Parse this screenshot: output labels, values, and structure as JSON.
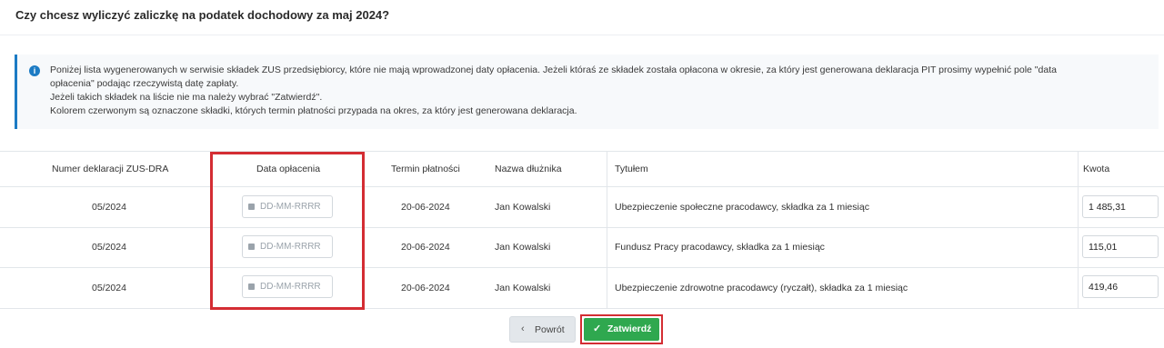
{
  "page": {
    "title": "Czy chcesz wyliczyć zaliczkę na podatek dochodowy za maj 2024?"
  },
  "info": {
    "icon": "info-circle-icon",
    "lines": [
      "Poniżej lista wygenerowanych w serwisie składek ZUS przedsiębiorcy, które nie mają wprowadzonej daty opłacenia. Jeżeli któraś ze składek została opłacona w okresie, za który jest generowana deklaracja PIT prosimy wypełnić pole \"data",
      "opłacenia\" podając rzeczywistą datę zapłaty.",
      "Jeżeli takich składek na liście nie ma należy wybrać \"Zatwierdź\".",
      "Kolorem czerwonym są oznaczone składki, których termin płatności przypada na okres, za który jest generowana deklaracja."
    ]
  },
  "table": {
    "headers": {
      "declaration": "Numer deklaracji ZUS-DRA",
      "payment_date": "Data opłacenia",
      "due_date": "Termin płatności",
      "debtor": "Nazwa dłużnika",
      "title": "Tytułem",
      "amount": "Kwota"
    },
    "rows": [
      {
        "declaration": "05/2024",
        "payment_date_placeholder": "DD-MM-RRRR",
        "due_date": "20-06-2024",
        "debtor": "Jan Kowalski",
        "title": "Ubezpieczenie społeczne pracodawcy, składka za 1 miesiąc",
        "amount": "1 485,31"
      },
      {
        "declaration": "05/2024",
        "payment_date_placeholder": "DD-MM-RRRR",
        "due_date": "20-06-2024",
        "debtor": "Jan Kowalski",
        "title": "Fundusz Pracy pracodawcy, składka za 1 miesiąc",
        "amount": "115,01"
      },
      {
        "declaration": "05/2024",
        "payment_date_placeholder": "DD-MM-RRRR",
        "due_date": "20-06-2024",
        "debtor": "Jan Kowalski",
        "title": "Ubezpieczenie zdrowotne pracodawcy (ryczałt), składka za 1 miesiąc",
        "amount": "419,46"
      }
    ]
  },
  "buttons": {
    "back": "Powrót",
    "confirm": "Zatwierdź"
  },
  "colors": {
    "accent_blue": "#1c7bc4",
    "confirm_green": "#2fa84f",
    "highlight_red": "#d42d33"
  }
}
